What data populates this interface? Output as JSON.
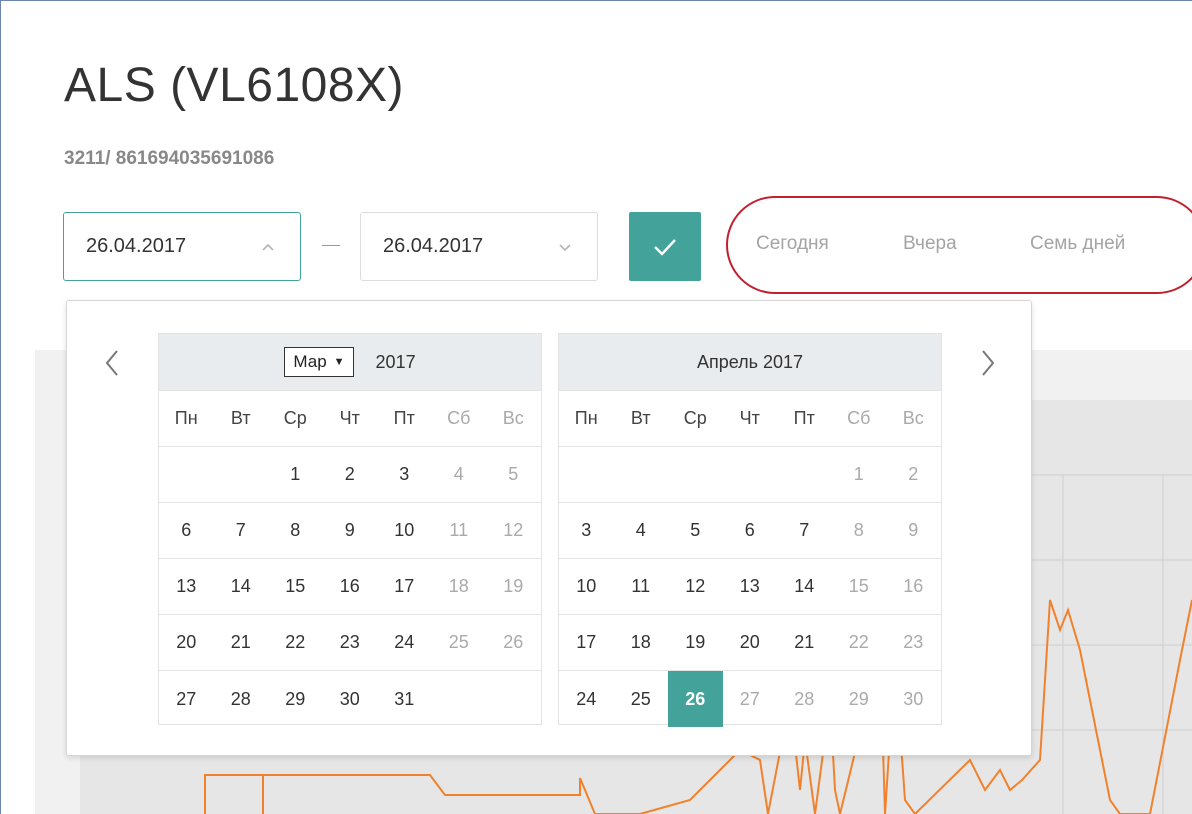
{
  "page": {
    "title": "ALS (VL6108X)",
    "subtitle": "3211/ 861694035691086"
  },
  "date_range": {
    "from": "26.04.2017",
    "to": "26.04.2017"
  },
  "quick_ranges": [
    "Сегодня",
    "Вчера",
    "Семь дней"
  ],
  "colors": {
    "accent": "#43a39a",
    "highlight_oval": "#c0202f",
    "series": "#f0822e"
  },
  "calendar": {
    "left": {
      "month_select": "Мар",
      "year": "2017",
      "weekdays": [
        "Пн",
        "Вт",
        "Ср",
        "Чт",
        "Пт",
        "Сб",
        "Вс"
      ],
      "weeks": [
        [
          "",
          "",
          "1",
          "2",
          "3",
          "4",
          "5"
        ],
        [
          "6",
          "7",
          "8",
          "9",
          "10",
          "11",
          "12"
        ],
        [
          "13",
          "14",
          "15",
          "16",
          "17",
          "18",
          "19"
        ],
        [
          "20",
          "21",
          "22",
          "23",
          "24",
          "25",
          "26"
        ],
        [
          "27",
          "28",
          "29",
          "30",
          "31",
          "",
          ""
        ]
      ]
    },
    "right": {
      "title": "Апрель 2017",
      "weekdays": [
        "Пн",
        "Вт",
        "Ср",
        "Чт",
        "Пт",
        "Сб",
        "Вс"
      ],
      "weeks": [
        [
          "",
          "",
          "",
          "",
          "",
          "1",
          "2"
        ],
        [
          "3",
          "4",
          "5",
          "6",
          "7",
          "8",
          "9"
        ],
        [
          "10",
          "11",
          "12",
          "13",
          "14",
          "15",
          "16"
        ],
        [
          "17",
          "18",
          "19",
          "20",
          "21",
          "22",
          "23"
        ],
        [
          "24",
          "25",
          "26",
          "27",
          "28",
          "29",
          "30"
        ]
      ],
      "selected_day": "26"
    }
  },
  "icons": {
    "from_chevron": "chevron-up-icon",
    "to_chevron": "chevron-down-icon",
    "apply": "checkmark-icon",
    "prev": "chevron-left-icon",
    "next": "chevron-right-icon"
  }
}
